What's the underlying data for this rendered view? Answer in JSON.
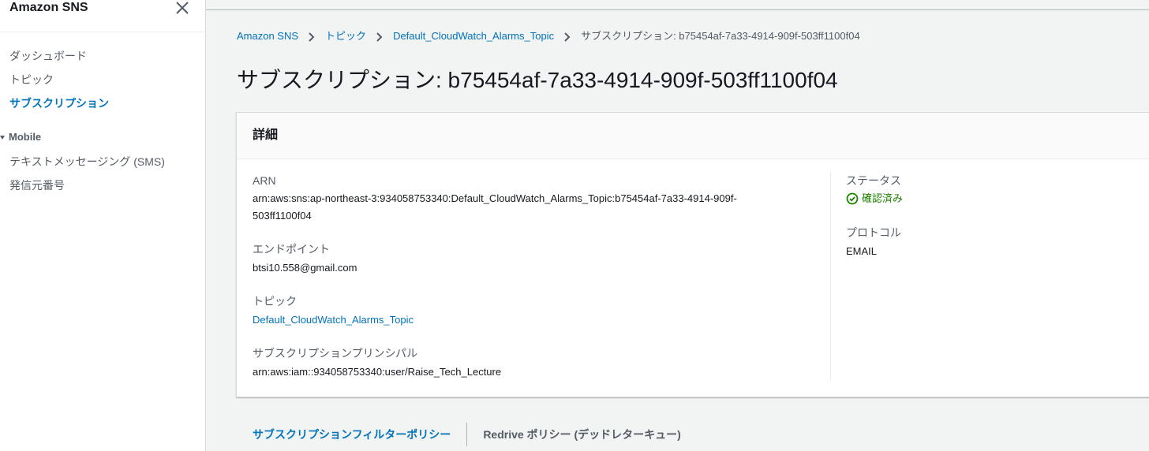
{
  "sidebar": {
    "title": "Amazon SNS",
    "items": [
      {
        "label": "ダッシュボード"
      },
      {
        "label": "トピック"
      },
      {
        "label": "サブスクリプション"
      }
    ],
    "section_label": "Mobile",
    "section_items": [
      {
        "label": "テキストメッセージング (SMS)"
      },
      {
        "label": "発信元番号"
      }
    ]
  },
  "breadcrumb": [
    {
      "label": "Amazon SNS"
    },
    {
      "label": "トピック"
    },
    {
      "label": "Default_CloudWatch_Alarms_Topic"
    },
    {
      "label": "サブスクリプション: b75454af-7a33-4914-909f-503ff1100f04"
    }
  ],
  "page_title": "サブスクリプション: b75454af-7a33-4914-909f-503ff1100f04",
  "details": {
    "title": "詳細",
    "arn_label": "ARN",
    "arn_value_line1": "arn:aws:sns:ap-northeast-3:934058753340:Default_CloudWatch_Alarms_Topic:b75454af-7a33-4914-909f-",
    "arn_value_line2": "503ff1100f04",
    "endpoint_label": "エンドポイント",
    "endpoint_value": "btsi10.558@gmail.com",
    "topic_label": "トピック",
    "topic_value": "Default_CloudWatch_Alarms_Topic",
    "principal_label": "サブスクリプションプリンシパル",
    "principal_value": "arn:aws:iam::934058753340:user/Raise_Tech_Lecture",
    "status_label": "ステータス",
    "status_value": "確認済み",
    "protocol_label": "プロトコル",
    "protocol_value": "EMAIL"
  },
  "tabs": [
    {
      "label": "サブスクリプションフィルターポリシー"
    },
    {
      "label": "Redrive ポリシー (デッドレターキュー)"
    }
  ],
  "colors": {
    "link": "#0073bb",
    "success": "#1d8102",
    "text": "#16191f",
    "muted": "#545b64"
  },
  "icons": {
    "close": "close-icon",
    "separator": "chevron-right-icon",
    "status": "check-circle-icon",
    "section": "caret-down-icon"
  }
}
